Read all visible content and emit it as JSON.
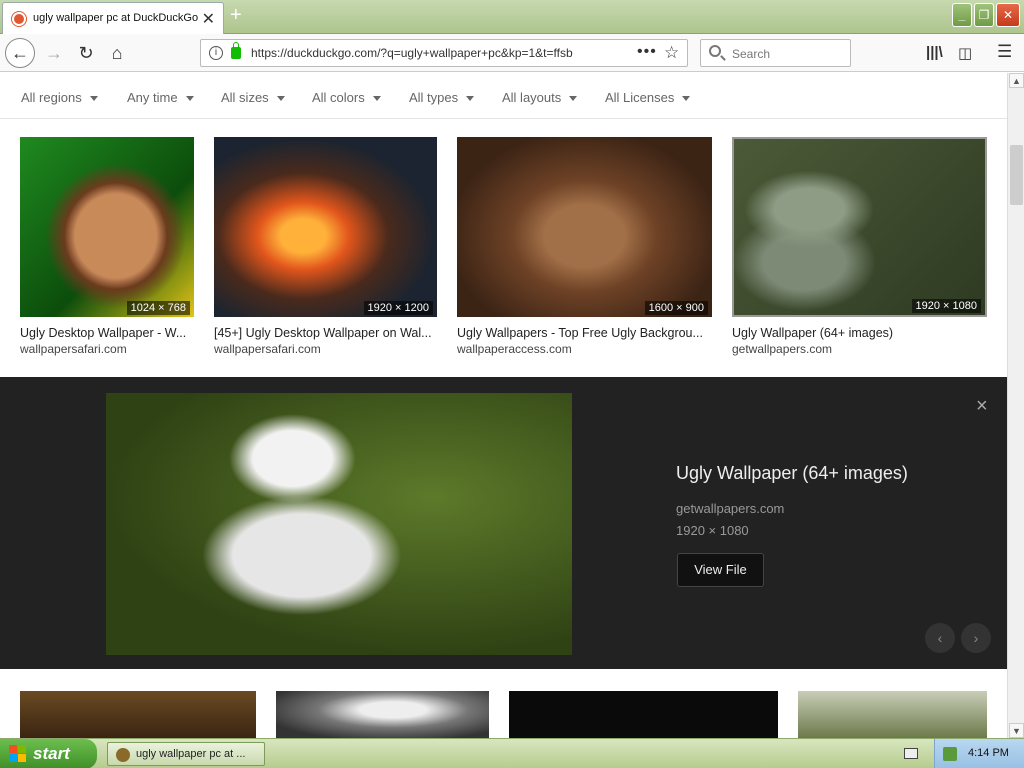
{
  "browser": {
    "tab_title": "ugly wallpaper pc at DuckDuckGo",
    "new_tab_symbol": "+",
    "url": "https://duckduckgo.com/?q=ugly+wallpaper+pc&kp=1&t=ffsb",
    "search_placeholder": "Search",
    "icons": [
      "back-icon",
      "forward-icon",
      "reload-icon",
      "home-icon",
      "info-icon",
      "lock-icon",
      "page-actions-icon",
      "bookmark-star-icon",
      "library-icon",
      "sidebar-icon",
      "menu-icon"
    ]
  },
  "filters": [
    {
      "label": "All regions"
    },
    {
      "label": "Any time"
    },
    {
      "label": "All sizes"
    },
    {
      "label": "All colors"
    },
    {
      "label": "All types"
    },
    {
      "label": "All layouts"
    },
    {
      "label": "All Licenses"
    }
  ],
  "results": [
    {
      "caption": "Ugly Desktop Wallpaper - W...",
      "source": "wallpapersafari.com",
      "dimensions": "1024 × 768"
    },
    {
      "caption": "[45+] Ugly Desktop Wallpaper on Wal...",
      "source": "wallpapersafari.com",
      "dimensions": "1920 × 1200"
    },
    {
      "caption": "Ugly Wallpapers - Top Free Ugly Backgrou...",
      "source": "wallpaperaccess.com",
      "dimensions": "1600 × 900"
    },
    {
      "caption": "Ugly Wallpaper (64+ images)",
      "source": "getwallpapers.com",
      "dimensions": "1920 × 1080"
    }
  ],
  "detail": {
    "title": "Ugly Wallpaper (64+ images)",
    "source": "getwallpapers.com",
    "dimensions": "1920 × 1080",
    "view_button": "View File",
    "close_symbol": "×",
    "prev_symbol": "‹",
    "next_symbol": "›"
  },
  "taskbar": {
    "start_label": "start",
    "window_item": "ugly wallpaper pc at ...",
    "clock": "4:14 PM"
  }
}
